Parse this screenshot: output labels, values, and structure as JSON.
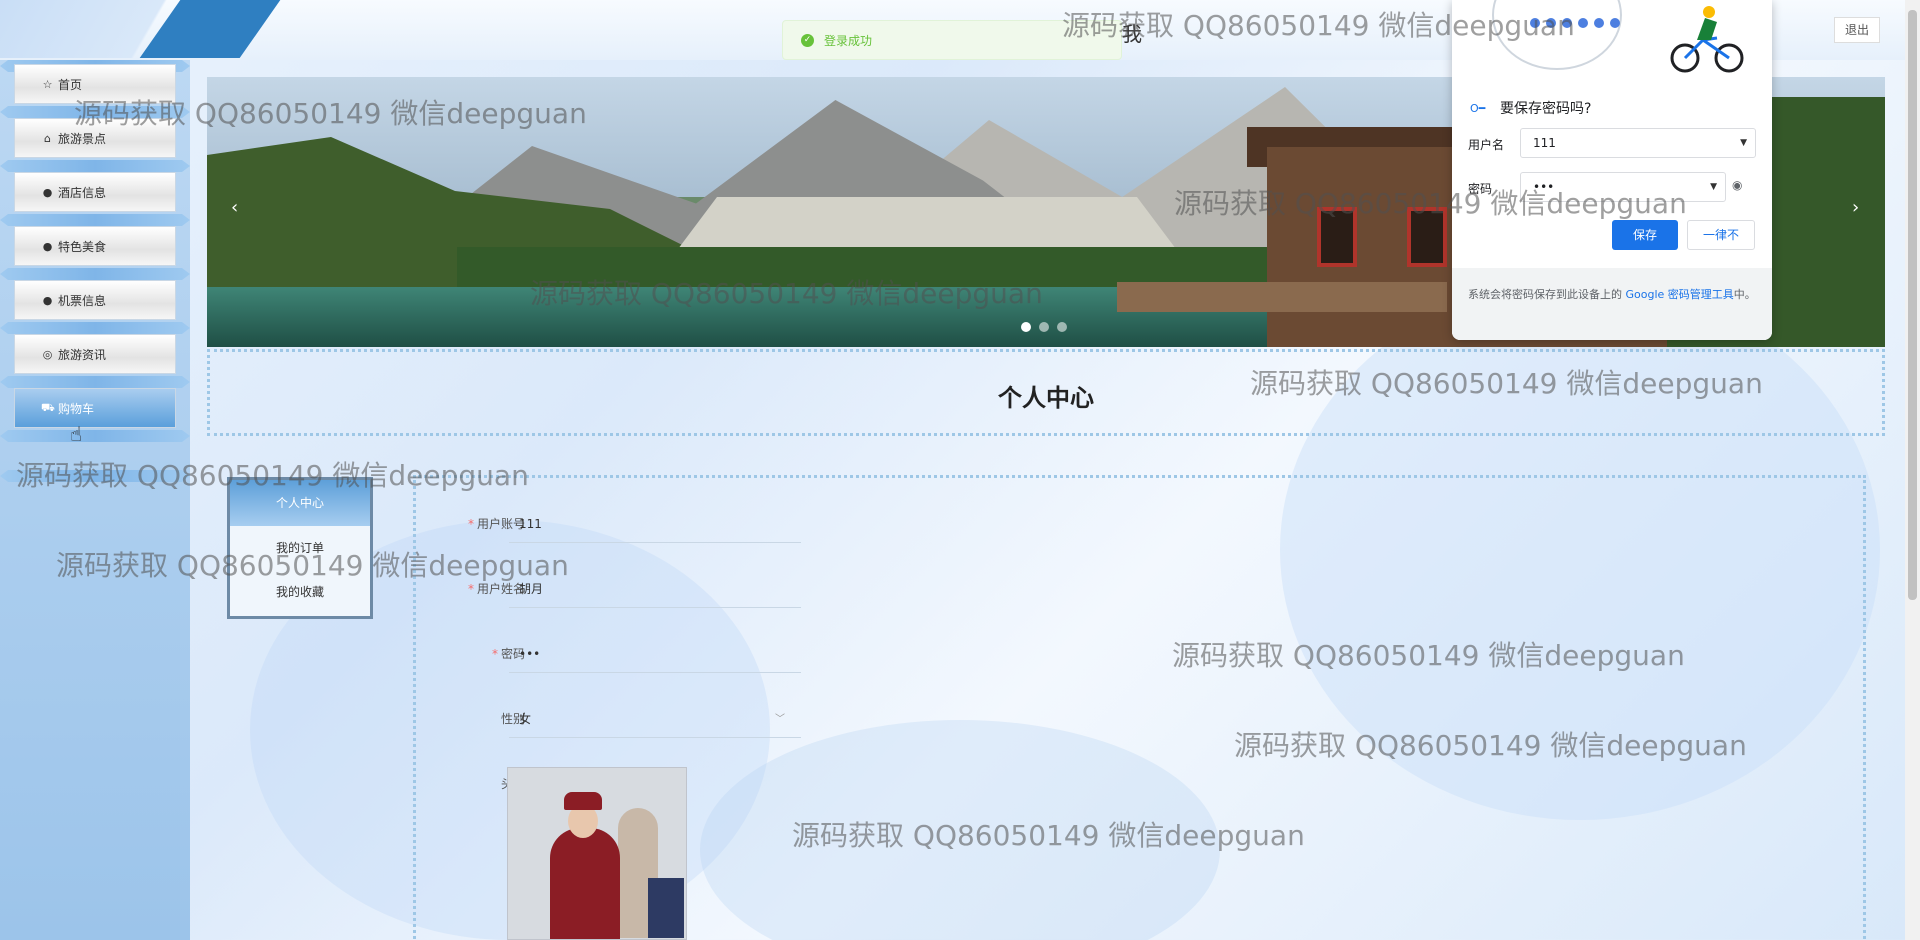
{
  "header": {
    "logout_label": "退出",
    "center_text": "我"
  },
  "toast": {
    "message": "登录成功"
  },
  "sidebar": {
    "items": [
      {
        "label": "首页",
        "icon": "star-icon"
      },
      {
        "label": "旅游景点",
        "icon": "bag-icon"
      },
      {
        "label": "酒店信息",
        "icon": "info-icon"
      },
      {
        "label": "特色美食",
        "icon": "help-icon"
      },
      {
        "label": "机票信息",
        "icon": "info-circle-icon"
      },
      {
        "label": "旅游资讯",
        "icon": "globe-icon"
      },
      {
        "label": "购物车",
        "icon": "cart-icon"
      }
    ]
  },
  "carousel": {
    "prev": "‹",
    "next": "›",
    "slide_count": 3,
    "active_slide": 1
  },
  "page_title": "个人中心",
  "submenu": {
    "head": "个人中心",
    "items": [
      "我的订单",
      "我的收藏"
    ]
  },
  "form": {
    "account": {
      "label": "用户账号",
      "value": "111"
    },
    "name": {
      "label": "用户姓名",
      "value": "胡月"
    },
    "password": {
      "label": "密码",
      "value": "•••"
    },
    "gender": {
      "label": "性别",
      "value": "女"
    },
    "avatar": {
      "label": "头像"
    }
  },
  "password_popup": {
    "title": "要保存密码吗?",
    "username_label": "用户名",
    "username_value": "111",
    "password_label": "密码",
    "password_value": "•••",
    "save_label": "保存",
    "never_label": "一律不",
    "footer_text": "系统会将密码保存到此设备上的 ",
    "footer_link": "Google 密码管理工具",
    "footer_end": "中。"
  },
  "watermark": "源码获取 QQ86050149 微信deepguan",
  "colors": {
    "accent": "#2f7fc1",
    "success": "#67c23a",
    "google_blue": "#1a73e8",
    "required": "#f56c6c"
  }
}
